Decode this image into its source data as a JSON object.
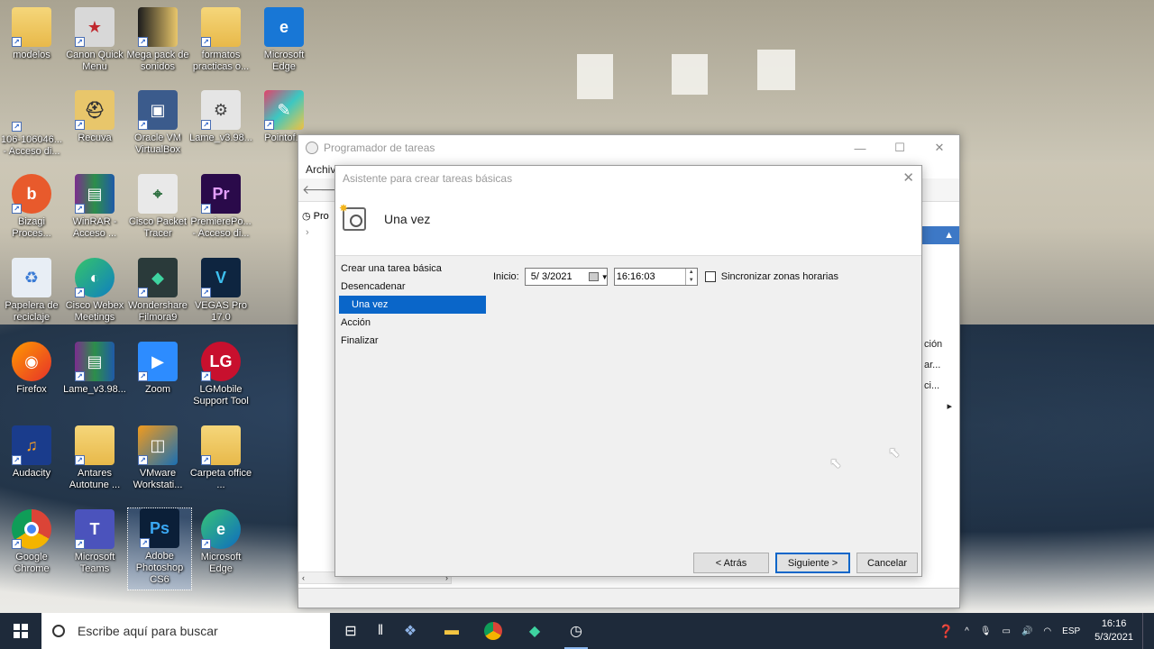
{
  "desktop": {
    "icons": [
      {
        "label": "modelos"
      },
      {
        "label": "Canon Quick Menu"
      },
      {
        "label": "Mega pack de sonidos"
      },
      {
        "label": "formatos practicas o..."
      },
      {
        "label": "Microsoft Edge"
      },
      {
        "label": "106-106046... - Acceso di..."
      },
      {
        "label": "Recuva"
      },
      {
        "label": "Oracle VM VirtualBox"
      },
      {
        "label": "Lame_v3.98..."
      },
      {
        "label": "Pointof..."
      },
      {
        "label": "Bizagi Proces..."
      },
      {
        "label": "WinRAR - Acceso ..."
      },
      {
        "label": "Cisco Packet Tracer"
      },
      {
        "label": "PremierePo... - Acceso di..."
      },
      {
        "label": "Papelera de reciclaje"
      },
      {
        "label": "Cisco Webex Meetings"
      },
      {
        "label": "Wondershare Filmora9"
      },
      {
        "label": "VEGAS Pro 17.0"
      },
      {
        "label": "Firefox"
      },
      {
        "label": "Lame_v3.98..."
      },
      {
        "label": "Zoom"
      },
      {
        "label": "LGMobile Support Tool"
      },
      {
        "label": "Audacity"
      },
      {
        "label": "Antares Autotune ..."
      },
      {
        "label": "VMware Workstati..."
      },
      {
        "label": "Carpeta office ..."
      },
      {
        "label": "Google Chrome"
      },
      {
        "label": "Microsoft Teams"
      },
      {
        "label": "Adobe Photoshop CS6"
      },
      {
        "label": "Microsoft Edge"
      }
    ]
  },
  "main_window": {
    "title": "Programador de tareas",
    "menu_first": "Archiv",
    "tree_item": "Pro",
    "right_items": [
      "ción",
      "ar...",
      "ci..."
    ]
  },
  "wizard": {
    "title": "Asistente para crear tareas básicas",
    "header_title": "Una vez",
    "steps": [
      {
        "label": "Crear una tarea básica"
      },
      {
        "label": "Desencadenar"
      },
      {
        "label": "Una vez"
      },
      {
        "label": "Acción"
      },
      {
        "label": "Finalizar"
      }
    ],
    "start_label": "Inicio:",
    "date_value": "5/ 3/2021",
    "time_value": "16:16:03",
    "sync_label": "Sincronizar zonas horarias",
    "buttons": {
      "back": "< Atrás",
      "next": "Siguiente >",
      "cancel": "Cancelar"
    }
  },
  "taskbar": {
    "search_placeholder": "Escribe aquí para buscar",
    "language": "ESP",
    "time": "16:16",
    "date": "5/3/2021"
  },
  "colors": {
    "accent": "#0a66c9",
    "taskbar": "#1e2a3a"
  }
}
